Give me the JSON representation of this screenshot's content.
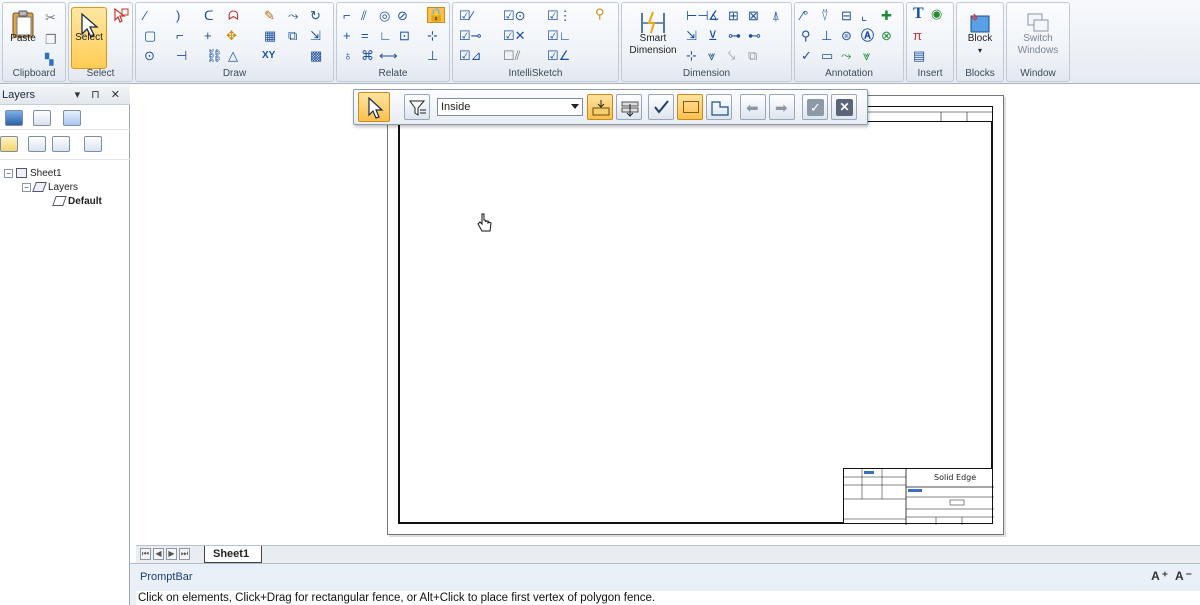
{
  "ribbon": {
    "groups": [
      {
        "label": "Clipboard"
      },
      {
        "label": "Select"
      },
      {
        "label": "Draw"
      },
      {
        "label": "Relate"
      },
      {
        "label": "IntelliSketch"
      },
      {
        "label": "Dimension"
      },
      {
        "label": "Annotation"
      },
      {
        "label": "Insert"
      },
      {
        "label": "Blocks"
      },
      {
        "label": "Window"
      }
    ],
    "paste_label": "Paste",
    "select_label": "Select",
    "smart_dimension_label_1": "Smart",
    "smart_dimension_label_2": "Dimension",
    "block_label": "Block",
    "switch_windows_label_1": "Switch",
    "switch_windows_label_2": "Windows",
    "xy_label": "XY"
  },
  "layers_pane": {
    "title": "Layers",
    "controls": "▾ ⊓ ✕",
    "tree": {
      "sheet": "Sheet1",
      "layers": "Layers",
      "default_layer": "Default"
    }
  },
  "fence_toolbar": {
    "mode_value": "Inside"
  },
  "sheet_tabs": {
    "active_tab": "Sheet1"
  },
  "prompt_bar": {
    "title": "PromptBar",
    "message": "Click on elements, Click+Drag for rectangular fence, or Alt+Click to place first vertex of polygon fence.",
    "font_controls": "A⁺ A⁻"
  },
  "title_block": {
    "company": "Solid Edge"
  },
  "colors": {
    "accent_active": "#fbc04d",
    "icon_blue": "#1f4f8a",
    "ribbon_bg": "#e6ebf2"
  }
}
